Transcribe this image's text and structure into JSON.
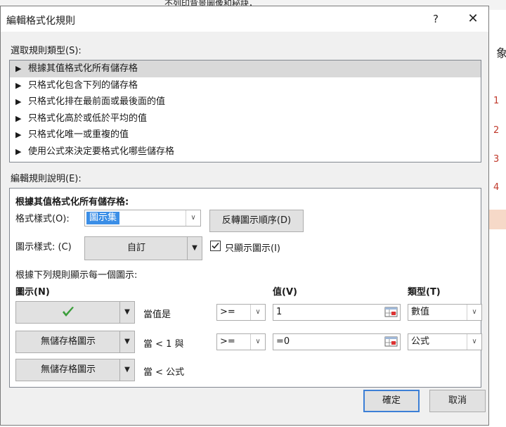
{
  "background": {
    "top_text": "不列印背景圖像和秘訣，",
    "right_numbers": [
      "1",
      "2",
      "3",
      "4"
    ],
    "right_char": "象"
  },
  "dialog": {
    "title": "編輯格式化規則",
    "help_glyph": "?",
    "close_glyph": "✕"
  },
  "rule_type": {
    "label": "選取規則類型(S):",
    "items": [
      "根據其值格式化所有儲存格",
      "只格式化包含下列的儲存格",
      "只格式化排在最前面或最後面的值",
      "只格式化高於或低於平均的值",
      "只格式化唯一或重複的值",
      "使用公式來決定要格式化哪些儲存格"
    ],
    "selected_index": 0
  },
  "description": {
    "label": "編輯規則說明(E):",
    "heading": "根據其值格式化所有儲存格:",
    "format_style_label": "格式樣式(O):",
    "format_style_value": "圖示集",
    "reverse_button": "反轉圖示順序(D)",
    "icon_style_label": "圖示樣式: (C)",
    "icon_style_value": "自訂",
    "show_icon_only_label": "只顯示圖示(I)",
    "show_icon_only_checked": true,
    "rule_caption": "根據下列規則顯示每一個圖示:",
    "col_icon": "圖示(N)",
    "col_value": "值(V)",
    "col_type": "類型(T)",
    "rows": [
      {
        "icon": "",
        "icon_name": "green-check-icon",
        "condition": "當值是",
        "operator": ">=",
        "value": "1",
        "type": "數值"
      },
      {
        "icon": "無儲存格圖示",
        "condition": "當 < 1 與",
        "operator": ">=",
        "value": "=0",
        "type": "公式"
      },
      {
        "icon": "無儲存格圖示",
        "condition": "當 < 公式"
      }
    ]
  },
  "footer": {
    "ok": "確定",
    "cancel": "取消"
  },
  "colors": {
    "accent": "#3b8ee6",
    "check_green": "#3a9d3a",
    "dialog_bg": "#f0f0f0"
  }
}
